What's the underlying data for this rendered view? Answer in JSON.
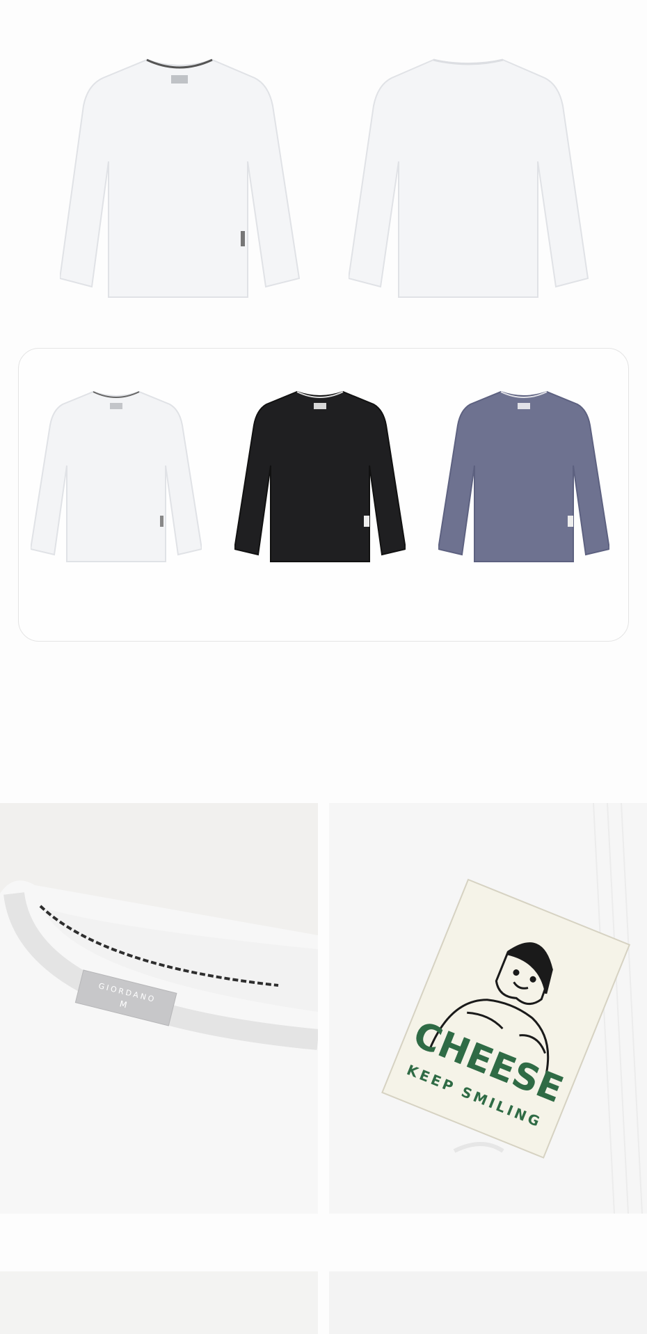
{
  "product": {
    "views": [
      {
        "name": "front-view",
        "color": "#f4f5f7"
      },
      {
        "name": "back-view",
        "color": "#f4f5f7"
      }
    ],
    "colorways": [
      {
        "name": "white",
        "color": "#f3f4f6"
      },
      {
        "name": "black",
        "color": "#1f1f21"
      },
      {
        "name": "slate-blue",
        "color": "#6e7290"
      }
    ]
  },
  "details": {
    "neck_label": {
      "brand": "GIORDANO",
      "size": "M"
    },
    "patch": {
      "headline": "CHEESE",
      "tagline": "KEEP SMILING",
      "headline_color": "#2f6b45",
      "patch_color": "#f5f3e8"
    }
  }
}
